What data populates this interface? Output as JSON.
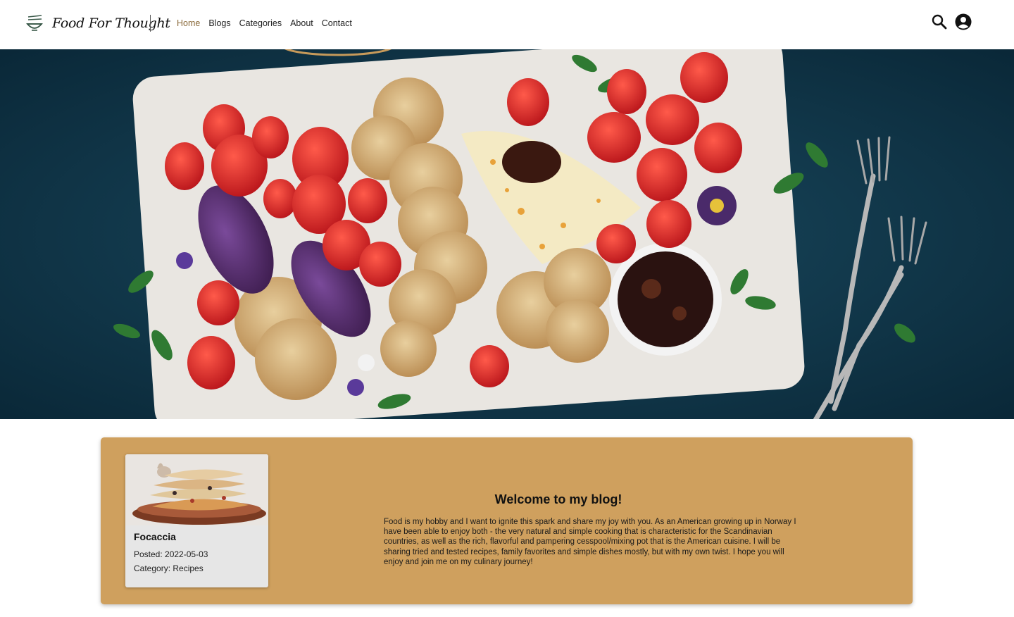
{
  "header": {
    "brand_name": "Food For Thought",
    "nav": [
      {
        "label": "Home",
        "active": true
      },
      {
        "label": "Blogs",
        "active": false
      },
      {
        "label": "Categories",
        "active": false
      },
      {
        "label": "About",
        "active": false
      },
      {
        "label": "Contact",
        "active": false
      }
    ],
    "icons": [
      "logo-bowl-icon",
      "search-icon",
      "user-account-icon"
    ]
  },
  "hero": {
    "image": "charcuterie-board-photo"
  },
  "welcome": {
    "title": "Welcome to my blog!",
    "text": "Food is my hobby and I want to ignite this spark and share my joy with you. As an American growing up in Norway I have been able to enjoy both - the very natural and simple cooking that is characteristic for the Scandinavian countries, as well as the rich, flavorful and pampering cesspool/mixing pot that is the American cuisine. I will be sharing tried and tested recipes, family favorites and simple dishes mostly, but with my own twist. I hope you will enjoy and join me on my culinary journey!",
    "featured_post": {
      "title": "Focaccia",
      "posted": "Posted: 2022-05-03",
      "category": "Category: Recipes"
    }
  },
  "colors": {
    "accent": "#cfa05e",
    "nav_active": "#8a6a3a",
    "hero_bg": "#0f3548"
  }
}
